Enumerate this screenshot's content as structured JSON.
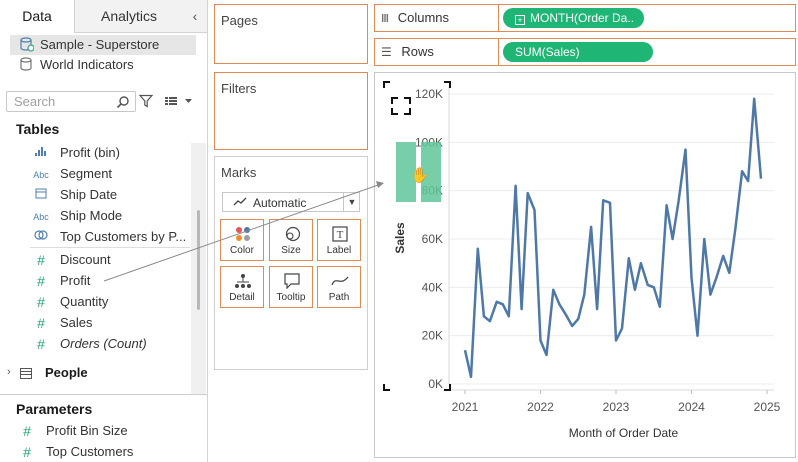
{
  "data_pane": {
    "tabs": [
      "Data",
      "Analytics"
    ],
    "collapse_glyph": "‹",
    "data_sources": [
      "Sample - Superstore",
      "World Indicators"
    ],
    "search": {
      "placeholder": "Search"
    },
    "tables_title": "Tables",
    "fields": [
      {
        "icon": "histogram-icon",
        "label": "Profit (bin)",
        "italic": false
      },
      {
        "icon": "abc-icon",
        "label": "Segment",
        "italic": false
      },
      {
        "icon": "calendar-icon",
        "label": "Ship Date",
        "italic": false
      },
      {
        "icon": "abc-icon",
        "label": "Ship Mode",
        "italic": false
      },
      {
        "icon": "set-icon",
        "label": "Top Customers by P...",
        "italic": false
      },
      {
        "icon": "hash-icon",
        "label": "Discount",
        "italic": false
      },
      {
        "icon": "hash-icon",
        "label": "Profit",
        "italic": false
      },
      {
        "icon": "hash-icon",
        "label": "Quantity",
        "italic": false
      },
      {
        "icon": "hash-icon",
        "label": "Sales",
        "italic": false
      },
      {
        "icon": "hash-icon",
        "label": "Orders (Count)",
        "italic": true
      }
    ],
    "people_group": "People",
    "parameters_title": "Parameters",
    "parameters": [
      "Profit Bin Size",
      "Top Customers"
    ]
  },
  "shelves": {
    "pages": "Pages",
    "filters": "Filters",
    "marks": "Marks",
    "marks_type": "Automatic",
    "mark_buttons": [
      "Color",
      "Size",
      "Label",
      "Detail",
      "Tooltip",
      "Path"
    ],
    "columns_label": "Columns",
    "columns_pill": "MONTH(Order Da..",
    "rows_label": "Rows",
    "rows_pill": "SUM(Sales)"
  },
  "colors": {
    "accent_border": "#e08a57",
    "pill_green": "#1fb575",
    "line_blue": "#4e79a7",
    "drop_target": "#5fc79b"
  },
  "chart_data": {
    "type": "line",
    "xlabel": "Month of Order Date",
    "ylabel": "Sales",
    "x_ticks": [
      "2021",
      "2022",
      "2023",
      "2024",
      "2025"
    ],
    "y_ticks": [
      "0K",
      "20K",
      "40K",
      "60K",
      "80K",
      "100K",
      "120K"
    ],
    "ylim": [
      0,
      120000
    ],
    "xlim": [
      2021.0,
      2025.0
    ],
    "grid": "horizontal",
    "series": [
      {
        "x": [
          2021.0,
          2021.08,
          2021.17,
          2021.25,
          2021.33,
          2021.42,
          2021.5,
          2021.58,
          2021.67,
          2021.75,
          2021.83,
          2021.92,
          2022.0,
          2022.08,
          2022.17,
          2022.25,
          2022.33,
          2022.42,
          2022.5,
          2022.58,
          2022.67,
          2022.75,
          2022.83,
          2022.92,
          2023.0,
          2023.08,
          2023.17,
          2023.25,
          2023.33,
          2023.42,
          2023.5,
          2023.58,
          2023.67,
          2023.75,
          2023.83,
          2023.92,
          2024.0,
          2024.08,
          2024.17,
          2024.25,
          2024.33,
          2024.42,
          2024.5,
          2024.58,
          2024.67,
          2024.75,
          2024.83,
          2024.92
        ],
        "y": [
          14000,
          3000,
          56000,
          28000,
          26000,
          34000,
          33000,
          28000,
          82000,
          31000,
          79000,
          72000,
          18000,
          12000,
          39000,
          33000,
          29000,
          24000,
          27000,
          37000,
          65000,
          31000,
          76000,
          75000,
          18000,
          23000,
          52000,
          39000,
          50000,
          41000,
          40000,
          32000,
          74000,
          60000,
          76000,
          97000,
          44000,
          20000,
          60000,
          37000,
          44000,
          53000,
          46000,
          64000,
          88000,
          84000,
          118000,
          85000
        ]
      }
    ]
  },
  "drag": {
    "glyph": "✋"
  }
}
